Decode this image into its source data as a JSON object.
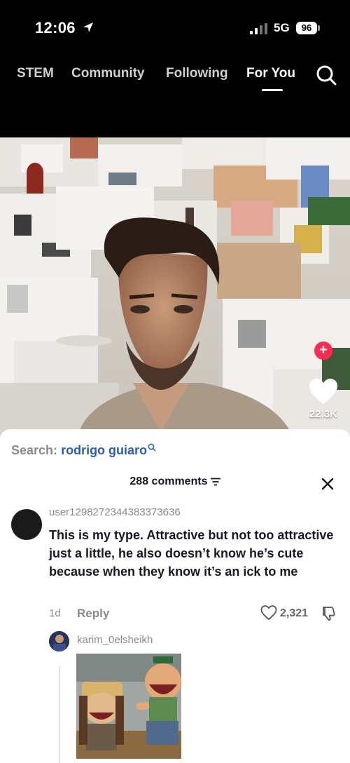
{
  "status_bar": {
    "time": "12:06",
    "network": "5G",
    "battery": "96"
  },
  "top_nav": {
    "tabs": [
      {
        "label": "STEM",
        "active": false
      },
      {
        "label": "Community",
        "active": false
      },
      {
        "label": "Following",
        "active": false
      },
      {
        "label": "For You",
        "active": true
      }
    ],
    "search_icon": "search-icon"
  },
  "video": {
    "scene": "whitewashed hillside village, man in foreground",
    "creator_avatar_icon": "creator-avatar",
    "follow_icon": "plus-icon",
    "like_icon": "heart-icon",
    "like_count": "22.3K"
  },
  "comments_sheet": {
    "search_prefix": "Search:",
    "search_query": "rodrigo guiaro",
    "search_query_icon": "magnifier-icon",
    "header": "288 comments",
    "filter_icon": "filter-icon",
    "close_icon": "close-icon",
    "comment": {
      "username": "user1298272344383373636",
      "text": "This is my type. Attractive but not too attractive just a little, he also doesn’t know he’s cute because when they know it’s an ick to me",
      "age": "1d",
      "reply_label": "Reply",
      "like_count": "2,321"
    },
    "reply": {
      "username": "karim_0elsheikh",
      "image": "cartoon-laughing-meme"
    }
  },
  "colors": {
    "accent_red": "#fe2c55",
    "search_query_blue": "#2c5fa8",
    "muted_gray": "#8a8a8a"
  }
}
